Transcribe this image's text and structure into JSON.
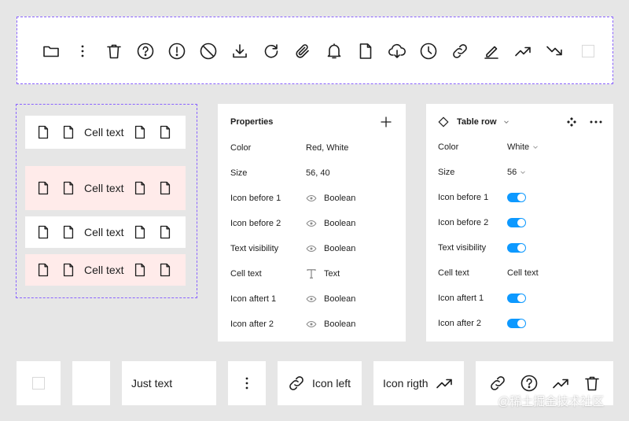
{
  "toolbar": {
    "icons": [
      "folder-icon",
      "more-vertical-icon",
      "trash-icon",
      "help-circle-icon",
      "alert-circle-icon",
      "ban-icon",
      "download-icon",
      "refresh-icon",
      "paperclip-icon",
      "bell-icon",
      "file-icon",
      "cloud-download-icon",
      "clock-icon",
      "link-icon",
      "pen-icon",
      "trending-up-icon",
      "trending-down-icon"
    ]
  },
  "rows": [
    {
      "text": "Cell text",
      "state": "default"
    },
    {
      "text": "Cell text",
      "state": "danger"
    },
    {
      "text": "Cell text",
      "state": "default"
    },
    {
      "text": "Cell text",
      "state": "danger"
    }
  ],
  "colors": {
    "background": "#e6e6e6",
    "dashed_border": "#8a63ff",
    "danger_row": "#ffebea",
    "toggle_on": "#0d99ff"
  },
  "properties_panel": {
    "title": "Properties",
    "add_symbol": "+",
    "items": [
      {
        "label": "Color",
        "value": "Red, White",
        "icon": ""
      },
      {
        "label": "Size",
        "value": "56, 40",
        "icon": ""
      },
      {
        "label": "Icon before 1",
        "value": "Boolean",
        "icon": "eye-icon"
      },
      {
        "label": "Icon before 2",
        "value": "Boolean",
        "icon": "eye-icon"
      },
      {
        "label": "Text visibility",
        "value": "Boolean",
        "icon": "eye-icon"
      },
      {
        "label": "Cell text",
        "value": "Text",
        "icon": "text-type-icon"
      },
      {
        "label": "Icon aftert 1",
        "value": "Boolean",
        "icon": "eye-icon"
      },
      {
        "label": "Icon after 2",
        "value": "Boolean",
        "icon": "eye-icon"
      }
    ]
  },
  "instance_panel": {
    "title": "Table row",
    "items": [
      {
        "label": "Color",
        "value": "White",
        "kind": "dropdown"
      },
      {
        "label": "Size",
        "value": "56",
        "kind": "dropdown"
      },
      {
        "label": "Icon before 1",
        "value": "on",
        "kind": "toggle"
      },
      {
        "label": "Icon before 2",
        "value": "on",
        "kind": "toggle"
      },
      {
        "label": "Text visibility",
        "value": "on",
        "kind": "toggle"
      },
      {
        "label": "Cell text",
        "value": "Cell text",
        "kind": "text"
      },
      {
        "label": "Icon aftert 1",
        "value": "on",
        "kind": "toggle"
      },
      {
        "label": "Icon after 2",
        "value": "on",
        "kind": "toggle"
      }
    ]
  },
  "bottom": {
    "just_text": "Just text",
    "icon_left": "Icon left",
    "icon_right": "Icon rigth"
  },
  "watermark": "@稀土掘金技术社区"
}
